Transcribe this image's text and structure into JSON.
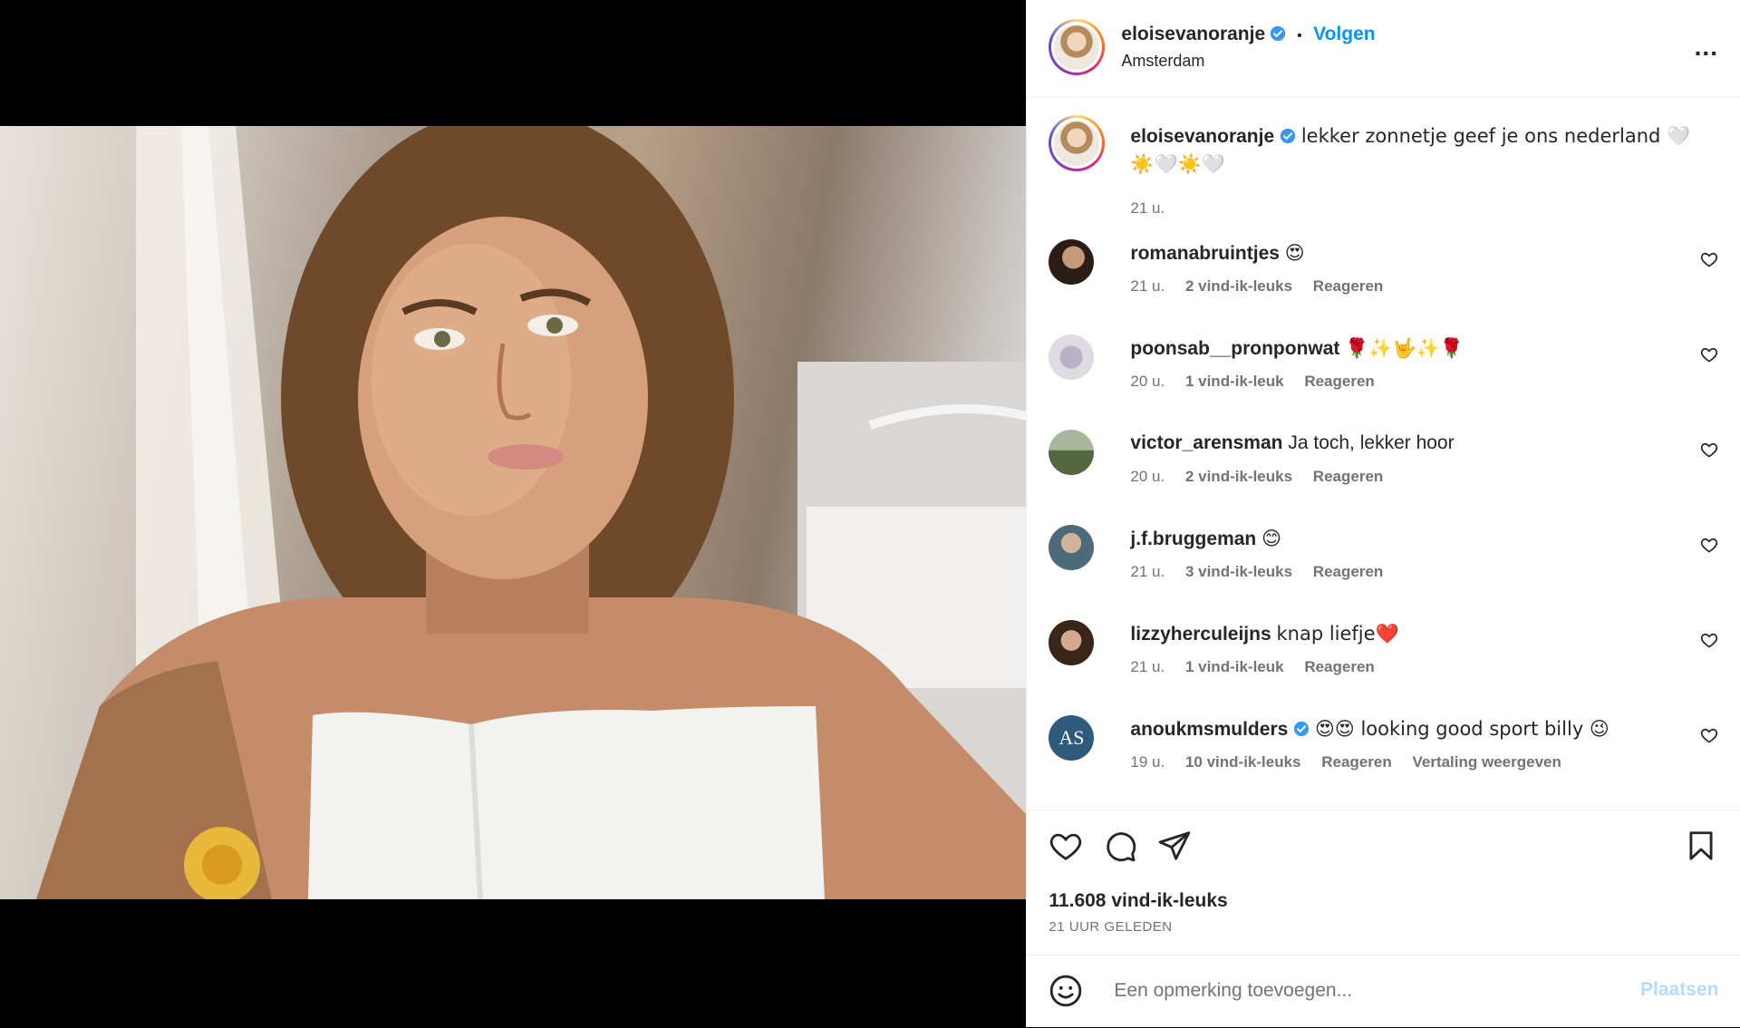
{
  "post": {
    "username": "eloisevanoranje",
    "follow_label": "Volgen",
    "separator": "•",
    "location": "Amsterdam",
    "more_label": "...",
    "caption": {
      "text": "lekker zonnetje geef je ons nederland 🤍☀️🤍☀️🤍",
      "time": "21 u."
    }
  },
  "comments": [
    {
      "username": "romanabruintjes",
      "text": "😍",
      "time": "21 u.",
      "likes": "2 vind-ik-leuks",
      "reply": "Reageren",
      "verified": false
    },
    {
      "username": "poonsab__pronponwat",
      "text": "🌹✨🤟✨🌹",
      "time": "20 u.",
      "likes": "1 vind-ik-leuk",
      "reply": "Reageren",
      "verified": false
    },
    {
      "username": "victor_arensman",
      "text": "Ja toch, lekker hoor",
      "time": "20 u.",
      "likes": "2 vind-ik-leuks",
      "reply": "Reageren",
      "verified": false
    },
    {
      "username": "j.f.bruggeman",
      "text": "😊",
      "time": "21 u.",
      "likes": "3 vind-ik-leuks",
      "reply": "Reageren",
      "verified": false
    },
    {
      "username": "lizzyherculeijns",
      "text": "knap liefje❤️",
      "time": "21 u.",
      "likes": "1 vind-ik-leuk",
      "reply": "Reageren",
      "verified": false
    },
    {
      "username": "anoukmsmulders",
      "text": "😍😍 looking good sport billy 😉",
      "time": "19 u.",
      "likes": "10 vind-ik-leuks",
      "reply": "Reageren",
      "translate": "Vertaling weergeven",
      "verified": true,
      "avatar_initials": "AS"
    }
  ],
  "footer": {
    "likes": "11.608 vind-ik-leuks",
    "ago": "21 UUR GELEDEN",
    "comment_placeholder": "Een opmerking toevoegen...",
    "post_label": "Plaatsen"
  },
  "icons": {
    "like": "heart-icon",
    "comment": "comment-bubble-icon",
    "share": "paper-plane-icon",
    "save": "bookmark-icon",
    "emoji": "smiley-icon",
    "verified": "verified-badge-icon",
    "more": "more-dots-icon"
  },
  "colors": {
    "link_blue": "#0095f6",
    "verified_blue": "#3897f0",
    "muted_text": "#737373",
    "disabled_post": "#b3dbff"
  }
}
